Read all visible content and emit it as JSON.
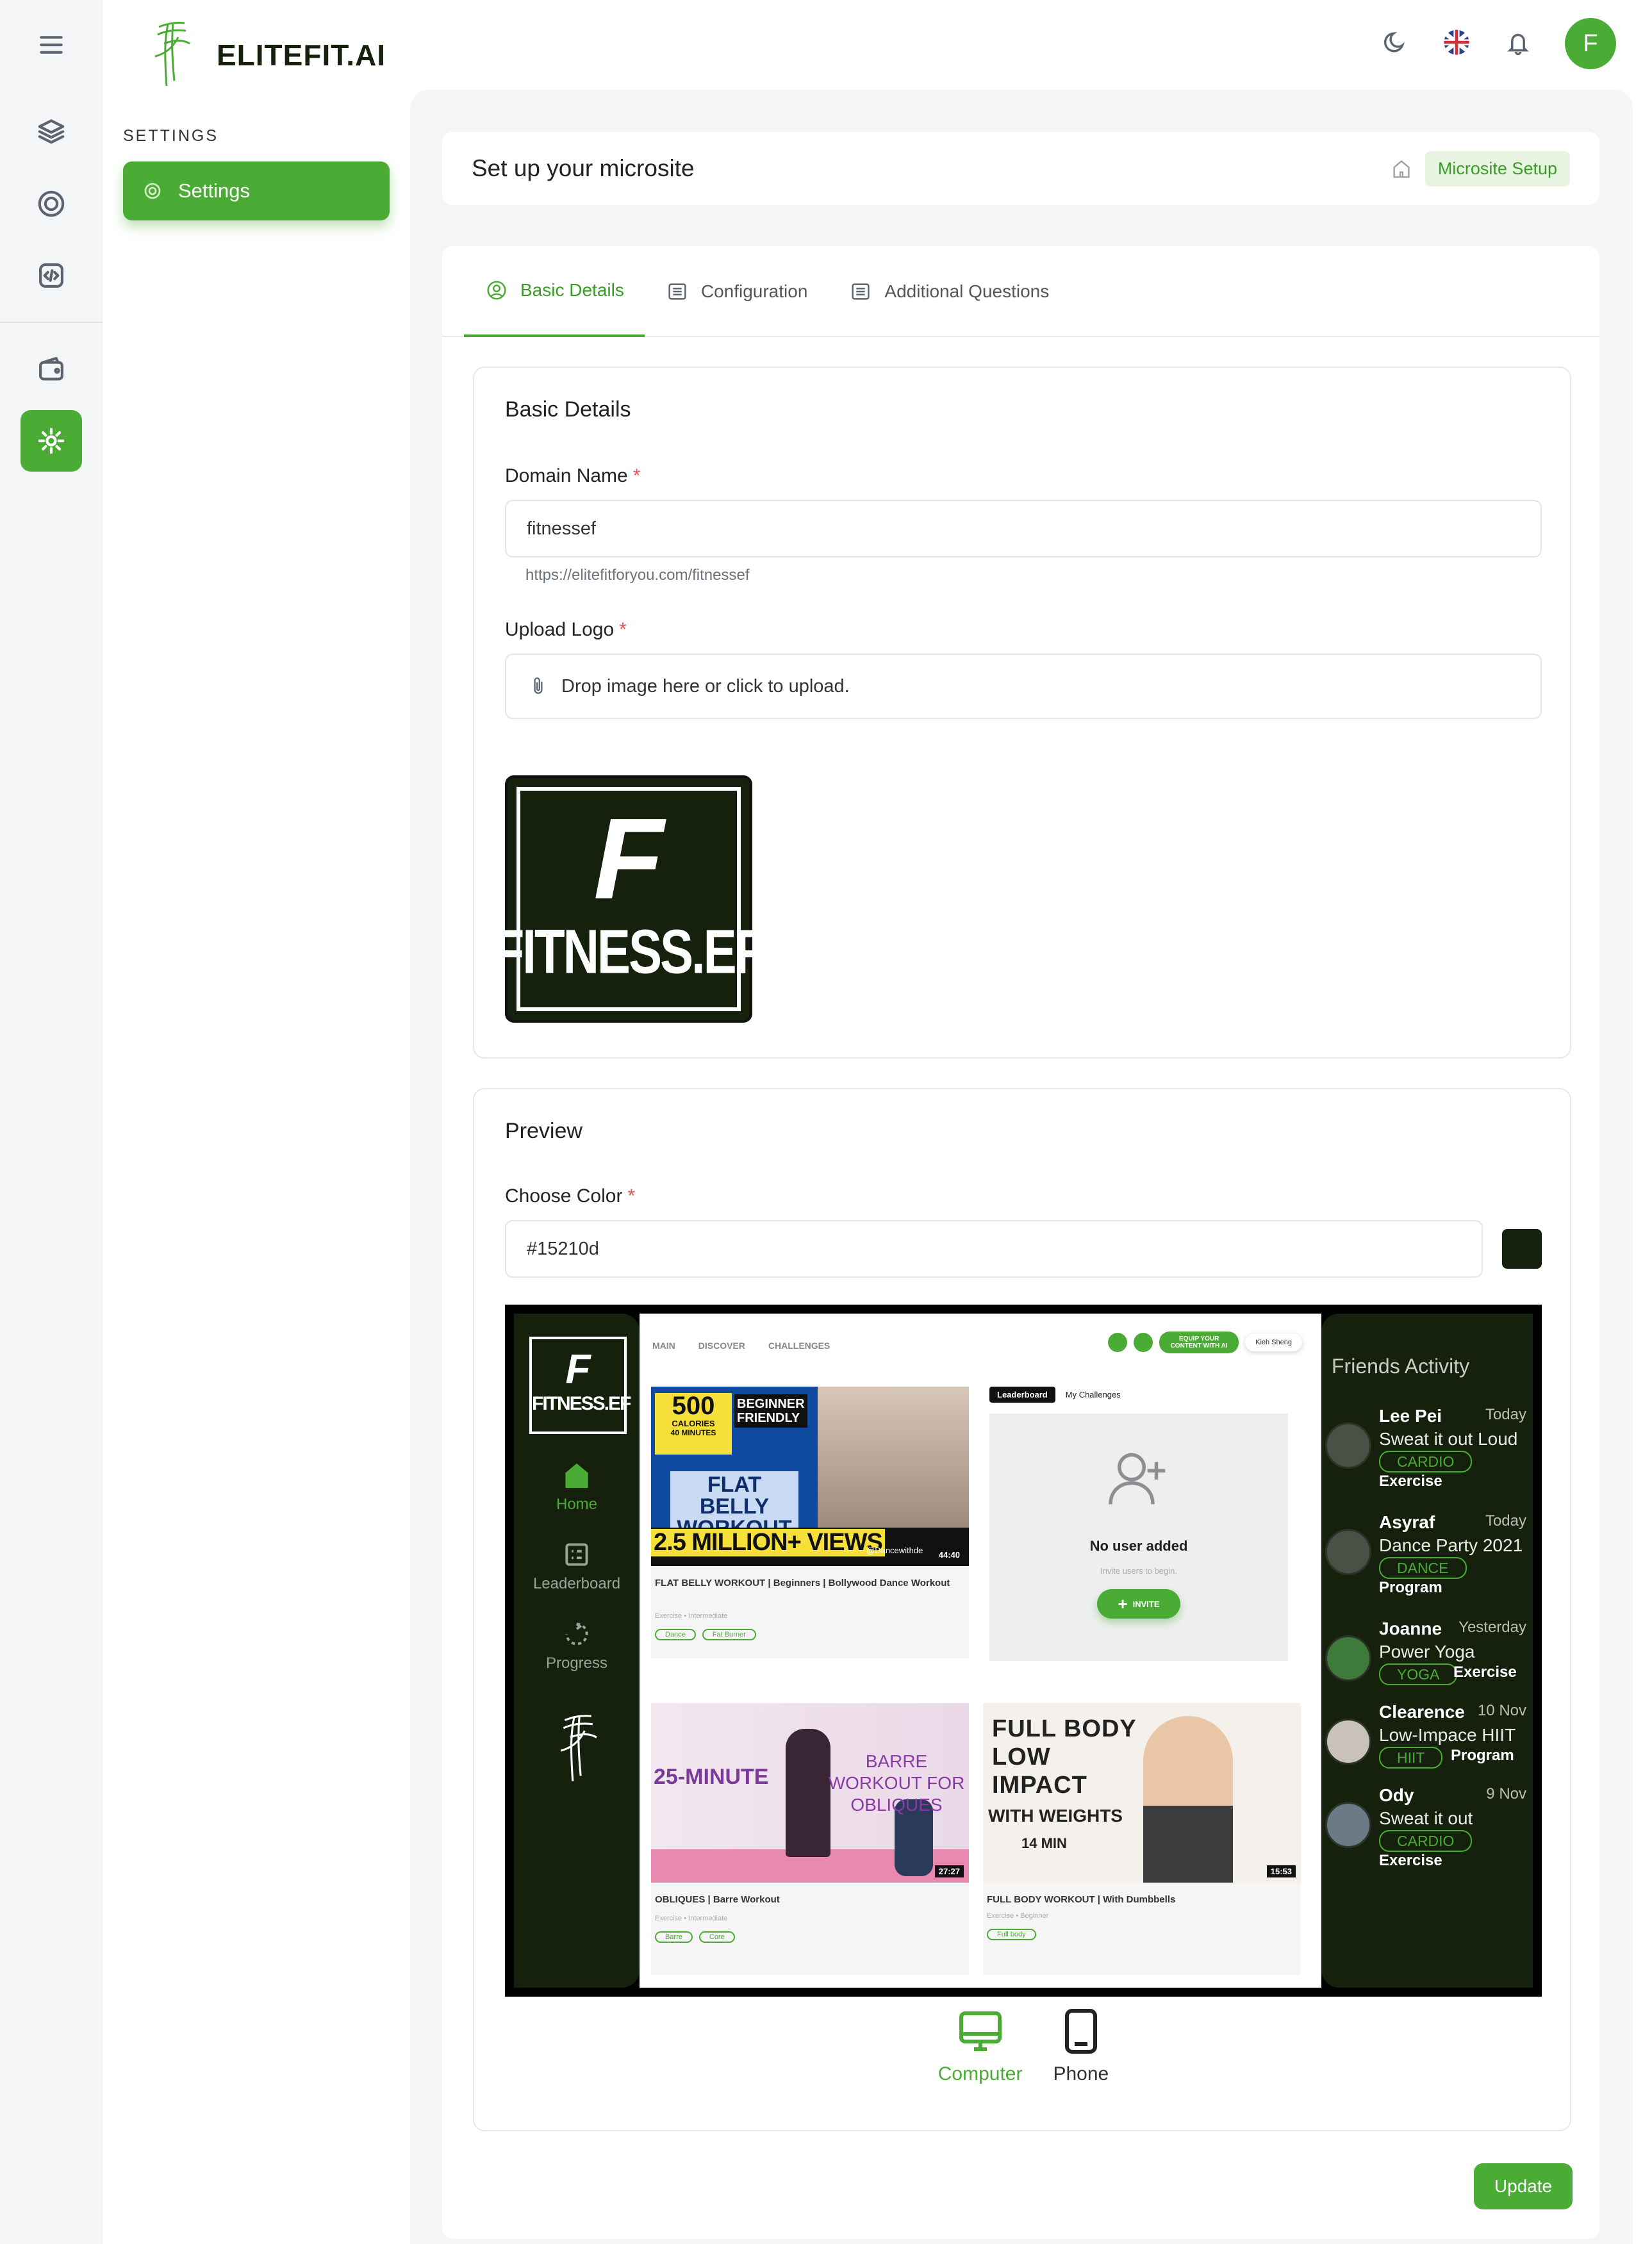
{
  "brand": {
    "name": "ELITEFIT.AI"
  },
  "sidebar": {
    "section": "SETTINGS",
    "item": "Settings"
  },
  "header": {
    "title": "Set up your microsite",
    "breadcrumb": "Microsite Setup",
    "avatar_initial": "F"
  },
  "tabs": [
    {
      "label": "Basic Details",
      "active": true
    },
    {
      "label": "Configuration",
      "active": false
    },
    {
      "label": "Additional Questions",
      "active": false
    }
  ],
  "basic": {
    "title": "Basic Details",
    "domain_label": "Domain Name",
    "required_mark": "*",
    "domain_value": "fitnessef",
    "domain_hint": "https://elitefitforyou.com/fitnessef",
    "logo_label": "Upload Logo",
    "upload_text": "Drop image here or click to upload.",
    "logo_letter": "F",
    "logo_text": "FITNESS.EF"
  },
  "preview": {
    "title": "Preview",
    "color_label": "Choose Color",
    "color_value": "#15210d",
    "nav": [
      "Home",
      "Leaderboard",
      "Progress"
    ],
    "top_tabs": [
      "MAIN",
      "DISCOVER",
      "CHALLENGES"
    ],
    "equip_button": "EQUIP YOUR CONTENT WITH AI",
    "user": "Kieh Sheng",
    "videos": [
      {
        "title": "FLAT BELLY WORKOUT | Beginners | Bollywood Dance Workout",
        "meta": "Exercise  •  Intermediate",
        "tags": [
          "Dance",
          "Fat Burner"
        ],
        "duration": "44:40",
        "thumb_calories": "500",
        "thumb_calories_sub": "CALORIES",
        "thumb_minutes": "40 MINUTES",
        "thumb_badge": "BEGINNER FRIENDLY",
        "thumb_title": "FLAT BELLY WORKOUT",
        "thumb_views": "2.5 MILLION+ VIEWS",
        "thumb_handle": "@Dancewithde"
      },
      {
        "title": "OBLIQUES | Barre Workout",
        "meta": "Exercise  •  Intermediate",
        "tags": [
          "Barre",
          "Core"
        ],
        "duration": "27:27",
        "thumb_left": "25-MINUTE",
        "thumb_right": "BARRE WORKOUT FOR OBLIQUES"
      },
      {
        "title": "FULL BODY WORKOUT | With Dumbbells",
        "meta": "Exercise  •  Beginner",
        "tags": [
          "Full body"
        ],
        "duration": "15:53",
        "thumb_title": "FULL BODY LOW IMPACT",
        "thumb_sub": "WITH WEIGHTS",
        "thumb_time": "14 MIN"
      }
    ],
    "leaderboard": {
      "tab1": "Leaderboard",
      "tab2": "My Challenges",
      "empty": "No user added",
      "sub": "Invite users to begin.",
      "invite": "INVITE"
    },
    "friends_title": "Friends Activity",
    "friends": [
      {
        "name": "Lee Pei",
        "date": "Today",
        "activity": "Sweat it out Loud",
        "tag": "CARDIO",
        "category": "Exercise"
      },
      {
        "name": "Asyraf",
        "date": "Today",
        "activity": "Dance Party 2021",
        "tag": "DANCE",
        "category": "Program"
      },
      {
        "name": "Joanne",
        "date": "Yesterday",
        "activity": "Power Yoga",
        "tag": "YOGA",
        "category": "Exercise"
      },
      {
        "name": "Clearence",
        "date": "10 Nov",
        "activity": "Low-Impace HIIT",
        "tag": "HIIT",
        "category": "Program"
      },
      {
        "name": "Ody",
        "date": "9 Nov",
        "activity": "Sweat it out",
        "tag": "CARDIO",
        "category": "Exercise"
      }
    ],
    "devices": [
      {
        "label": "Computer",
        "active": true
      },
      {
        "label": "Phone",
        "active": false
      }
    ]
  },
  "actions": {
    "update": "Update"
  },
  "colors": {
    "accent": "#4aac34",
    "brand_dark": "#15210d",
    "background": "#f4f5f7"
  }
}
